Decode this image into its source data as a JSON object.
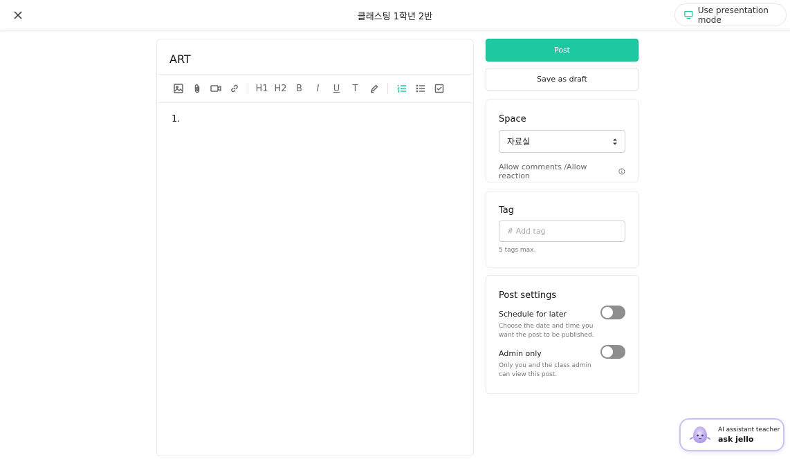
{
  "topbar": {
    "title": "클래스팅 1학년 2반",
    "presentation_label": "Use presentation mode"
  },
  "editor": {
    "title": "ART",
    "toolbar": [
      "image-icon",
      "attachment-icon",
      "video-icon",
      "link-icon",
      "heading-1",
      "heading-2",
      "bold",
      "italic",
      "underline",
      "clear-format",
      "highlight-icon",
      "ordered-list-icon",
      "bullet-list-icon",
      "checklist-icon"
    ],
    "heading1_label": "H1",
    "heading2_label": "H2",
    "bold_label": "B",
    "italic_label": "I",
    "underline_label": "U",
    "clear_format_label": "T",
    "body_text": "1."
  },
  "actions": {
    "post_label": "Post",
    "draft_label": "Save as draft"
  },
  "space": {
    "title": "Space",
    "selected": "자료실",
    "allow_text": "Allow comments /Allow reaction"
  },
  "tag": {
    "title": "Tag",
    "placeholder": "# Add tag",
    "hint": "5 tags max."
  },
  "post_settings": {
    "title": "Post settings",
    "schedule_label": "Schedule for later",
    "schedule_desc": "Choose the date and time you want the post to be published.",
    "schedule_on": false,
    "admin_label": "Admin only",
    "admin_desc": "Only you and the class admin can view this post.",
    "admin_on": false
  },
  "assistant": {
    "subtitle": "AI assistant teacher",
    "name": "ask jello"
  },
  "colors": {
    "accent": "#1ec8a0",
    "toggle_off": "#8e8e8e",
    "assistant_border": "#c9c3f3"
  }
}
